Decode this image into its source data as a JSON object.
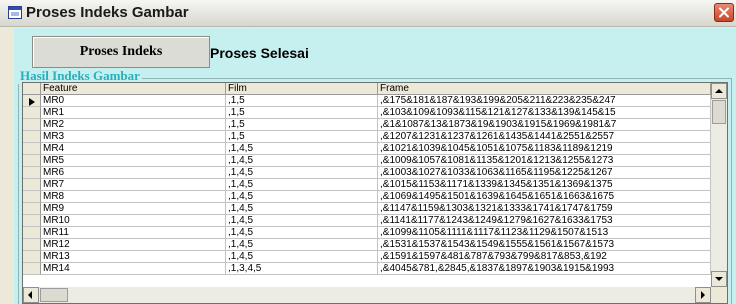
{
  "window": {
    "title": "Proses Indeks Gambar",
    "app_icon": "window-app-icon",
    "close_icon": "close-icon"
  },
  "toolbar": {
    "proses_button_label": "Proses Indeks",
    "status_text": "Proses Selesai"
  },
  "group": {
    "title": "Hasil Indeks Gambar"
  },
  "grid": {
    "columns": [
      "Feature",
      "Film",
      "Frame"
    ],
    "selected_row": 0,
    "rows": [
      {
        "feature": "MR0",
        "film": ",1,5",
        "frame": ",&175&181&187&193&199&205&211&223&235&247"
      },
      {
        "feature": "MR1",
        "film": ",1,5",
        "frame": ",&103&109&1093&115&121&127&133&139&145&15"
      },
      {
        "feature": "MR2",
        "film": ",1,5",
        "frame": ",&1&1087&13&1873&19&1903&1915&1969&1981&7"
      },
      {
        "feature": "MR3",
        "film": ",1,5",
        "frame": ",&1207&1231&1237&1261&1435&1441&2551&2557"
      },
      {
        "feature": "MR4",
        "film": ",1,4,5",
        "frame": ",&1021&1039&1045&1051&1075&1183&1189&1219"
      },
      {
        "feature": "MR5",
        "film": ",1,4,5",
        "frame": ",&1009&1057&1081&1135&1201&1213&1255&1273"
      },
      {
        "feature": "MR6",
        "film": ",1,4,5",
        "frame": ",&1003&1027&1033&1063&1165&1195&1225&1267"
      },
      {
        "feature": "MR7",
        "film": ",1,4,5",
        "frame": ",&1015&1153&1171&1339&1345&1351&1369&1375"
      },
      {
        "feature": "MR8",
        "film": ",1,4,5",
        "frame": ",&1069&1495&1501&1639&1645&1651&1663&1675"
      },
      {
        "feature": "MR9",
        "film": ",1,4,5",
        "frame": ",&1147&1159&1303&1321&1333&1741&1747&1759"
      },
      {
        "feature": "MR10",
        "film": ",1,4,5",
        "frame": ",&1141&1177&1243&1249&1279&1627&1633&1753"
      },
      {
        "feature": "MR11",
        "film": ",1,4,5",
        "frame": ",&1099&1105&1111&1117&1123&1129&1507&1513"
      },
      {
        "feature": "MR12",
        "film": ",1,4,5",
        "frame": ",&1531&1537&1543&1549&1555&1561&1567&1573"
      },
      {
        "feature": "MR13",
        "film": ",1,4,5",
        "frame": ",&1591&1597&481&787&793&799&817&853,&192"
      },
      {
        "feature": "MR14",
        "film": ",1,3,4,5",
        "frame": ",&4045&781,&2845,&1837&1897&1903&1915&1993"
      }
    ]
  },
  "scrollbars": {
    "up_icon": "scroll-up-icon",
    "down_icon": "scroll-down-icon",
    "left_icon": "scroll-left-icon",
    "right_icon": "scroll-right-icon"
  },
  "colors": {
    "panel_background": "#c6efef",
    "group_title": "#27b1bd",
    "window_face": "#ece9d8",
    "close_button": "#c9462a"
  }
}
